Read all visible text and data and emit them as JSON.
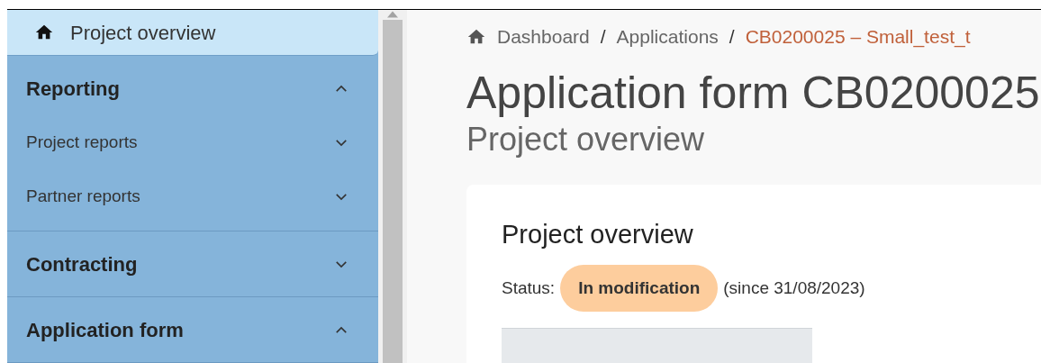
{
  "sidebar": {
    "home": {
      "label": "Project overview",
      "selected": true
    },
    "sections": [
      {
        "label": "Reporting",
        "expanded": true,
        "items": [
          {
            "label": "Project reports",
            "expanded": false
          },
          {
            "label": "Partner reports",
            "expanded": false
          }
        ]
      },
      {
        "label": "Contracting",
        "expanded": false
      },
      {
        "label": "Application form",
        "expanded": true
      }
    ]
  },
  "breadcrumb": [
    {
      "label": "Dashboard",
      "current": false
    },
    {
      "label": "/",
      "kind": "separator"
    },
    {
      "label": "Applications",
      "current": false
    },
    {
      "label": "/",
      "kind": "separator"
    },
    {
      "label": "CB0200025 – Small_test_t",
      "current": true
    }
  ],
  "page": {
    "title": "Application form CB0200025",
    "subtitle": "Project overview"
  },
  "card": {
    "title": "Project overview",
    "status_label": "Status:",
    "status": "In modification",
    "since": "(since 31/08/2023)"
  }
}
